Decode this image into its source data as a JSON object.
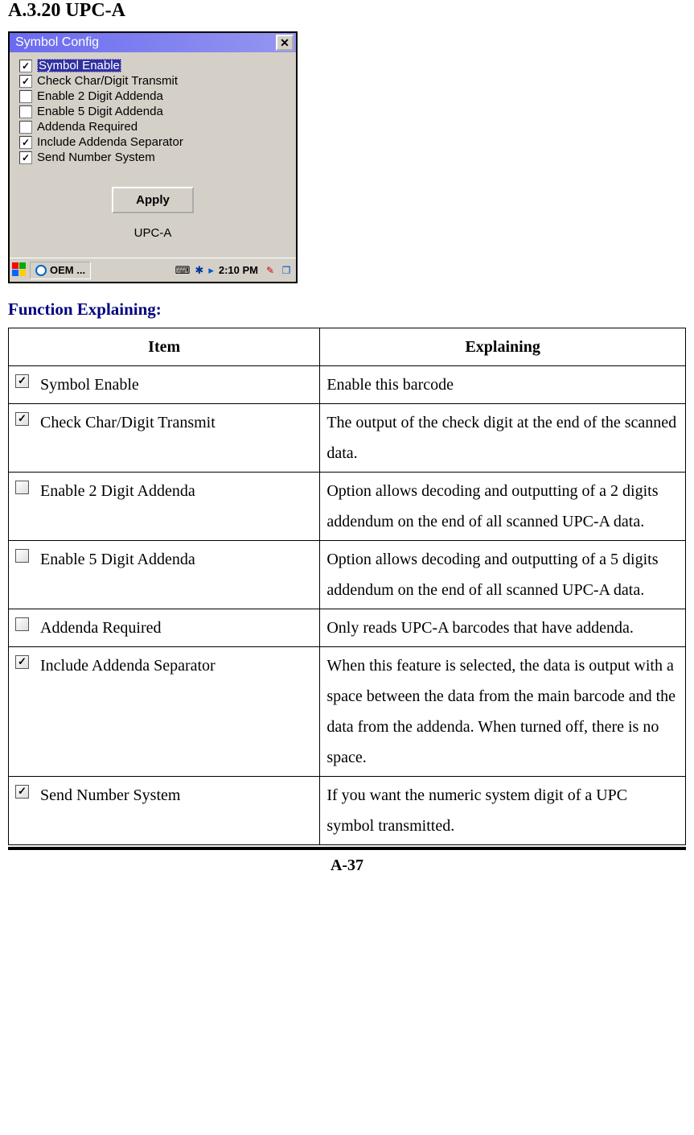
{
  "section_heading": "A.3.20 UPC-A",
  "window": {
    "title": "Symbol Config",
    "options": [
      {
        "label": "Symbol Enable",
        "checked": true,
        "selected": true
      },
      {
        "label": "Check Char/Digit Transmit",
        "checked": true,
        "selected": false
      },
      {
        "label": "Enable 2 Digit Addenda",
        "checked": false,
        "selected": false
      },
      {
        "label": "Enable 5 Digit Addenda",
        "checked": false,
        "selected": false
      },
      {
        "label": "Addenda Required",
        "checked": false,
        "selected": false
      },
      {
        "label": "Include Addenda Separator",
        "checked": true,
        "selected": false
      },
      {
        "label": "Send Number System",
        "checked": true,
        "selected": false
      }
    ],
    "apply_label": "Apply",
    "status_label": "UPC-A"
  },
  "taskbar": {
    "task_label": "OEM ...",
    "time": "2:10 PM"
  },
  "function_heading": "Function Explaining:",
  "table": {
    "headers": {
      "item": "Item",
      "explaining": "Explaining"
    },
    "rows": [
      {
        "checked": true,
        "item": "Symbol Enable",
        "explain": "Enable this barcode"
      },
      {
        "checked": true,
        "item": "Check Char/Digit Transmit",
        "explain": "The output of the check digit at the end of the scanned data."
      },
      {
        "checked": false,
        "item": "Enable 2 Digit Addenda",
        "explain": "Option allows decoding and outputting of a 2 digits addendum on the end of all scanned UPC-A data."
      },
      {
        "checked": false,
        "item": "Enable 5 Digit Addenda",
        "explain": "Option allows decoding and outputting of a 5 digits addendum on the end of all scanned UPC-A data."
      },
      {
        "checked": false,
        "item": "Addenda Required",
        "explain": "Only reads UPC-A barcodes that have addenda."
      },
      {
        "checked": true,
        "item": "Include Addenda Separator",
        "explain": "When this feature is selected, the data is output with a space between the data from the main barcode and the data from the addenda. When turned off, there is no space."
      },
      {
        "checked": true,
        "item": "Send Number System",
        "explain": "If you want the numeric system digit of a UPC symbol transmitted."
      }
    ]
  },
  "page_number": "A-37"
}
